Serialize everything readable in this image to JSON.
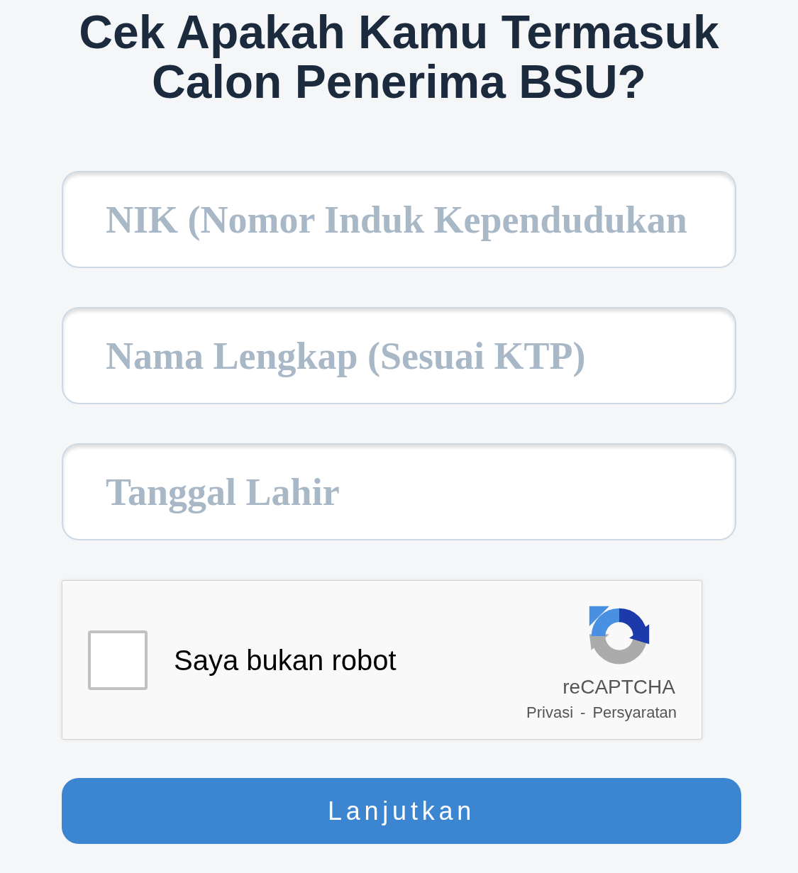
{
  "heading": "Cek Apakah Kamu Termasuk Calon Penerima BSU?",
  "fields": [
    {
      "placeholder": "NIK (Nomor Induk Kependudukan"
    },
    {
      "placeholder": "Nama Lengkap (Sesuai KTP)"
    },
    {
      "placeholder": "Tanggal Lahir"
    }
  ],
  "captcha": {
    "checked": false,
    "label": "Saya bukan robot",
    "brand": "reCAPTCHA",
    "links": [
      "Privasi",
      "Persyaratan"
    ],
    "separator": "-"
  },
  "submit_button": {
    "label": "Lanjutkan"
  }
}
